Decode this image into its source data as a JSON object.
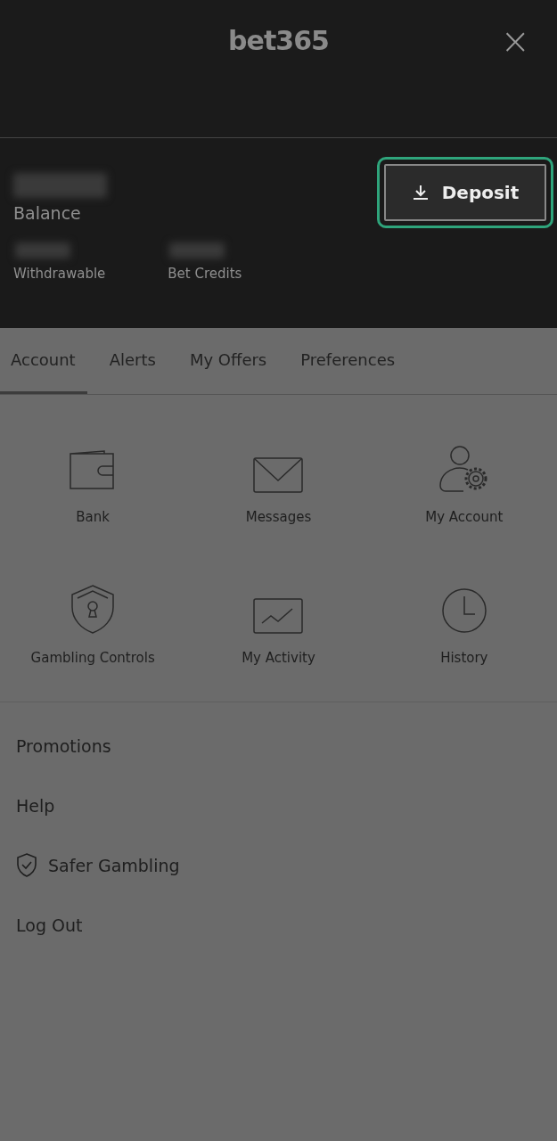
{
  "header": {
    "logo": "bet365",
    "close": "×"
  },
  "balance": {
    "label": "Balance",
    "deposit": {
      "label": "Deposit",
      "highlighted": true
    },
    "sub": [
      {
        "label": "Withdrawable"
      },
      {
        "label": "Bet Credits"
      }
    ]
  },
  "tabs": [
    {
      "label": "Account",
      "selected": true
    },
    {
      "label": "Alerts",
      "selected": false
    },
    {
      "label": "My Offers",
      "selected": false
    },
    {
      "label": "Preferences",
      "selected": false
    }
  ],
  "tiles": [
    {
      "label": "Bank",
      "kind": "wallet"
    },
    {
      "label": "Messages",
      "kind": "envelope"
    },
    {
      "label": "My Account",
      "kind": "person-gear"
    },
    {
      "label": "Gambling Controls",
      "kind": "shield-lock"
    },
    {
      "label": "My Activity",
      "kind": "chart"
    },
    {
      "label": "History",
      "kind": "clock"
    }
  ],
  "menu": [
    {
      "label": "Promotions",
      "kind": "plain"
    },
    {
      "label": "Help",
      "kind": "plain"
    },
    {
      "label": "Safer Gambling",
      "kind": "shield"
    },
    {
      "label": "Log Out",
      "kind": "plain"
    }
  ]
}
